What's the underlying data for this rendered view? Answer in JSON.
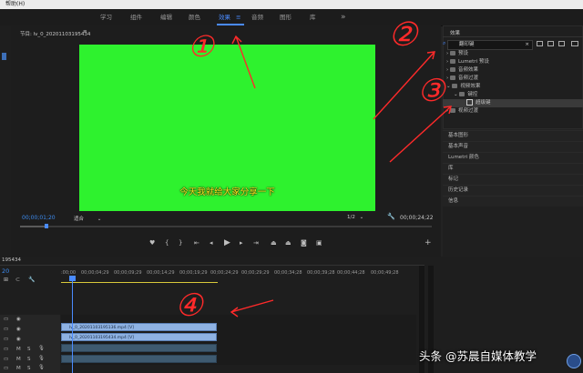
{
  "menubar": {
    "item": "帮助(H)"
  },
  "workspace": {
    "tabs": [
      "学习",
      "组件",
      "编辑",
      "颜色",
      "效果",
      "音频",
      "图形",
      "库"
    ],
    "active_index": 4,
    "menu_glyph": "≡",
    "more_glyph": "»"
  },
  "program": {
    "title": "节目: lv_0_20201103195434",
    "menu_glyph": "≡",
    "subtitle": "今天我就给大家分享一下",
    "time_current": "00;00;01;20",
    "fit": "适合",
    "quality": "1/2",
    "time_duration": "00;00;24;22"
  },
  "effects": {
    "title": "效果",
    "search_value": "翻印键",
    "tree": [
      {
        "label": "预设",
        "level": 0
      },
      {
        "label": "Lumetri 预设",
        "level": 0
      },
      {
        "label": "音频效果",
        "level": 0
      },
      {
        "label": "音频过渡",
        "level": 0
      },
      {
        "label": "视频效果",
        "level": 0
      },
      {
        "label": "键控",
        "level": 1
      },
      {
        "label": "超级键",
        "level": 2
      },
      {
        "label": "视频过渡",
        "level": 0
      }
    ]
  },
  "side_panels": [
    "基本图形",
    "基本声音",
    "Lumetri 颜色",
    "库",
    "标记",
    "历史记录",
    "信息"
  ],
  "timeline": {
    "title": "195434",
    "time": "20",
    "ruler_labels": [
      ":00;00",
      "00;00;04;29",
      "00;00;09;29",
      "00;00;14;29",
      "00;00;19;29",
      "00;00;24;29",
      "00;00;29;29",
      "00;00;34;28",
      "00;00;39;28",
      "00;00;44;28",
      "00;00;49;28",
      "00;00;54;28"
    ],
    "clips": [
      {
        "label": "lv_0_20201103195136.mp4 [V]"
      },
      {
        "label": "lv_0_20201103195434.mp4 [V]"
      }
    ]
  },
  "annotations": {
    "a1": "①",
    "a2": "②",
    "a3": "③",
    "a4": "④"
  },
  "watermark": "头条 @苏晨自媒体教学",
  "colors": {
    "accent": "#4a8bff",
    "green_screen": "#2ef22e",
    "annotation": "#ff2a2a",
    "subtitle": "#ffe820"
  }
}
